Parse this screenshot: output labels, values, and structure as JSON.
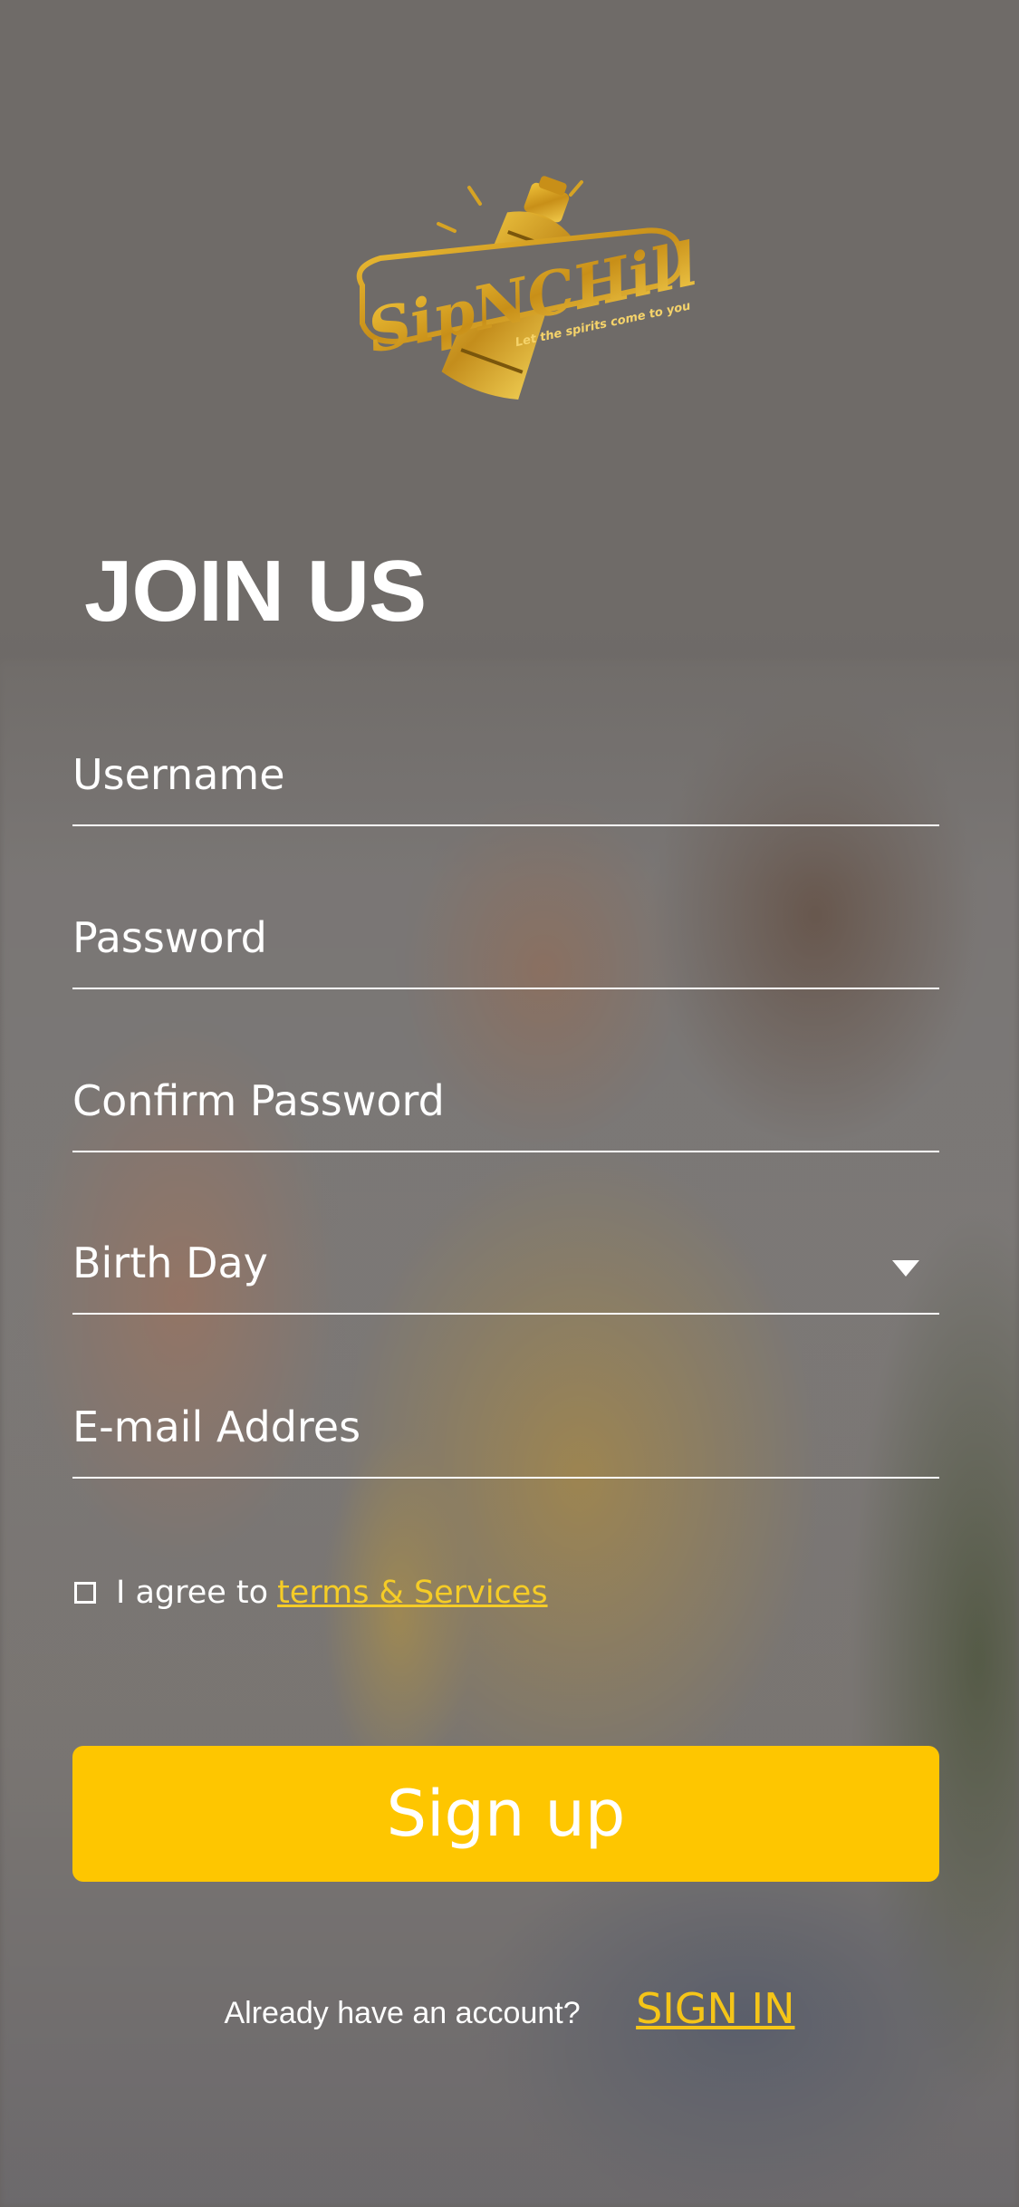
{
  "app": {
    "brand_name": "SipNCHill",
    "tagline": "Let the spirits come to you"
  },
  "header": {
    "title": "JOIN US"
  },
  "form": {
    "username_placeholder": "Username",
    "password_placeholder": "Password",
    "confirm_password_placeholder": "Confirm Password",
    "birthday_placeholder": "Birth Day",
    "email_placeholder": "E-mail Addres",
    "agree_prefix": "I agree to",
    "agree_link": "terms & Services",
    "agree_checked": false,
    "signup_label": "Sign up"
  },
  "footer": {
    "question": "Already have an account?",
    "signin_label": "SIGN IN"
  },
  "colors": {
    "accent": "#fec600",
    "link": "#f5cc27",
    "background": "#6f6b68",
    "logo_gold": "#d6a324"
  }
}
